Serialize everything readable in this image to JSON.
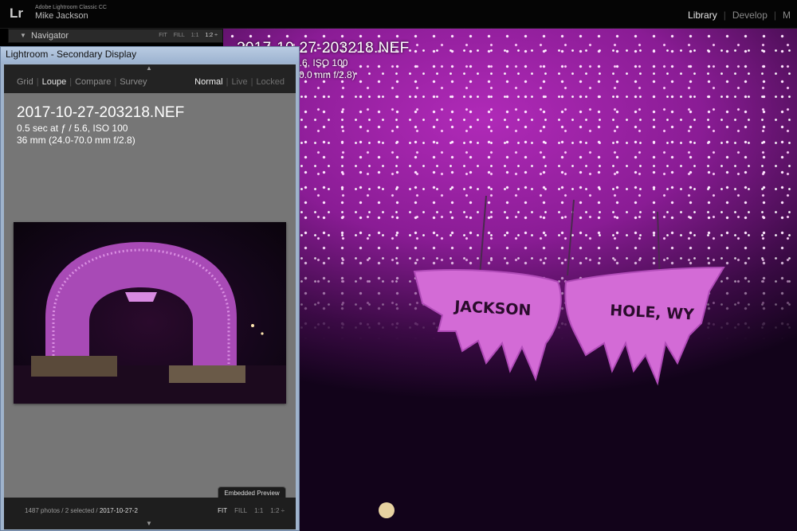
{
  "app": {
    "logo": "Lr",
    "name": "Adobe Lightroom Classic CC",
    "user": "Mike Jackson"
  },
  "modules": [
    {
      "label": "Library",
      "active": true
    },
    {
      "label": "Develop",
      "active": false
    },
    {
      "label": "M",
      "active": false
    }
  ],
  "navigator": {
    "title": "Navigator",
    "zoom": [
      "FIT",
      "FILL",
      "1:1",
      "1:2 ÷"
    ],
    "active_zoom": "1:2 ÷"
  },
  "main_view": {
    "filename": "2017-10-27-203218.NEF",
    "exposure": "0.5 sec at ƒ / 5.6, ISO 100",
    "lens": "36 mm (24.0-70.0 mm f/2.8)",
    "sign_left": "JACKSON",
    "sign_right": "HOLE, WY"
  },
  "secondary_window": {
    "title": "Lightroom - Secondary Display",
    "view_tabs": [
      "Grid",
      "Loupe",
      "Compare",
      "Survey"
    ],
    "active_view": "Loupe",
    "mode_tabs": [
      "Normal",
      "Live",
      "Locked"
    ],
    "active_mode": "Normal",
    "filename": "2017-10-27-203218.NEF",
    "exposure": "0.5 sec at ƒ / 5.6, ISO 100",
    "lens": "36 mm (24.0-70.0 mm f/2.8)",
    "embedded_preview": "Embedded Preview",
    "footer": {
      "count": "1487 photos / 2 selected /",
      "current_file": "2017-10-27-2",
      "zoom": [
        "FIT",
        "FILL",
        "1:1",
        "1:2 ÷"
      ],
      "active_zoom": "FIT"
    }
  },
  "colors": {
    "accent_magenta": "#b02ab8",
    "window_frame": "#9fb3cc"
  }
}
